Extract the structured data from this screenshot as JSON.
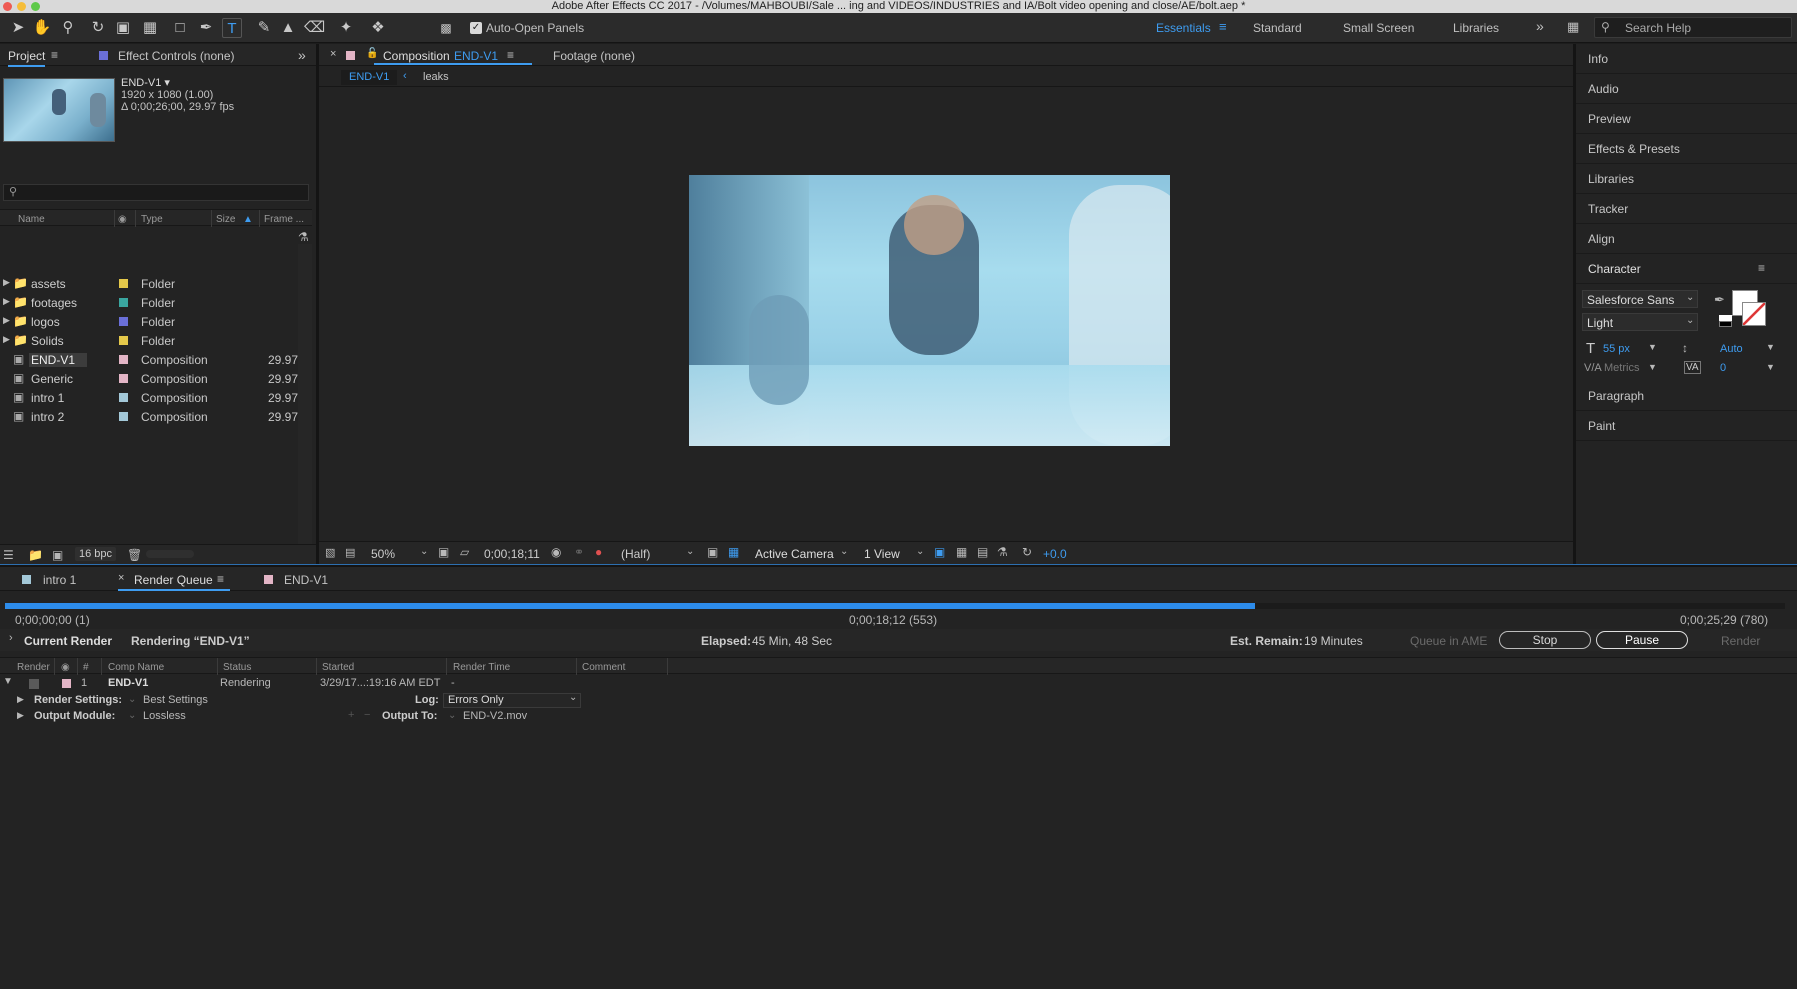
{
  "window": {
    "title": "Adobe After Effects CC 2017 - /Volumes/MAHBOUBI/Sale ... ing and VIDEOS/INDUSTRIES and IA/Bolt video opening and close/AE/bolt.aep *"
  },
  "toolbar": {
    "auto_open_label": "Auto-Open Panels",
    "workspaces": [
      "Essentials",
      "Standard",
      "Small Screen",
      "Libraries"
    ],
    "search_placeholder": "Search Help"
  },
  "project_panel": {
    "tab_project": "Project",
    "tab_effect_controls": "Effect Controls (none)",
    "selected_name": "END-V1 ▾",
    "selected_res": "1920 x 1080 (1.00)",
    "selected_dur": "Δ 0;00;26;00, 29.97 fps",
    "columns": {
      "name": "Name",
      "type": "Type",
      "size": "Size",
      "frame": "Frame ..."
    },
    "items": [
      {
        "name": "assets",
        "type": "Folder",
        "frame": "",
        "color": "#e4c84a"
      },
      {
        "name": "footages",
        "type": "Folder",
        "frame": "",
        "color": "#3aa6a0"
      },
      {
        "name": "logos",
        "type": "Folder",
        "frame": "",
        "color": "#6a6fd8"
      },
      {
        "name": "Solids",
        "type": "Folder",
        "frame": "",
        "color": "#e4c84a"
      },
      {
        "name": "END-V1",
        "type": "Composition",
        "frame": "29.97",
        "color": "#e3b5c6"
      },
      {
        "name": "Generic",
        "type": "Composition",
        "frame": "29.97",
        "color": "#e3b5c6"
      },
      {
        "name": "intro 1",
        "type": "Composition",
        "frame": "29.97",
        "color": "#a3c8d8"
      },
      {
        "name": "intro 2",
        "type": "Composition",
        "frame": "29.97",
        "color": "#a3c8d8"
      }
    ],
    "bpc": "16 bpc"
  },
  "composition_panel": {
    "tab_composition": "Composition",
    "tab_comp_name": "END-V1",
    "tab_footage": "Footage (none)",
    "breadcrumb": [
      "END-V1",
      "leaks"
    ],
    "zoom": "50%",
    "timecode": "0;00;18;11",
    "resolution": "(Half)",
    "camera": "Active Camera",
    "views": "1 View",
    "exposure": "+0.0"
  },
  "right_panel": {
    "items_top": [
      "Info",
      "Audio",
      "Preview",
      "Effects & Presets",
      "Libraries",
      "Tracker",
      "Align",
      "Character"
    ],
    "font_family": "Salesforce Sans",
    "font_style": "Light",
    "font_size": "55 px",
    "leading": "Auto",
    "kerning": "Metrics",
    "tracking": "0",
    "items_bottom": [
      "Paragraph",
      "Paint"
    ]
  },
  "render_queue": {
    "tabs": [
      "intro 1",
      "Render Queue",
      "END-V1"
    ],
    "progress": 0.702,
    "time_start": "0;00;00;00 (1)",
    "time_current": "0;00;18;12 (553)",
    "time_end": "0;00;25;29 (780)",
    "current_render_label": "Current Render",
    "rendering_text": "Rendering “END-V1”",
    "elapsed_label": "Elapsed:",
    "elapsed_value": "45 Min, 48 Sec",
    "remain_label": "Est. Remain:",
    "remain_value": "19 Minutes",
    "queue_ame": "Queue in AME",
    "stop": "Stop",
    "pause": "Pause",
    "render": "Render",
    "columns": {
      "render": "Render",
      "num": "#",
      "comp": "Comp Name",
      "status": "Status",
      "started": "Started",
      "render_time": "Render Time",
      "comment": "Comment"
    },
    "item": {
      "num": "1",
      "comp": "END-V1",
      "status": "Rendering",
      "started": "3/29/17...:19:16 AM EDT",
      "render_time": "-"
    },
    "render_settings_label": "Render Settings:",
    "render_settings_value": "Best Settings",
    "log_label": "Log:",
    "log_value": "Errors Only",
    "output_module_label": "Output Module:",
    "output_module_value": "Lossless",
    "output_to_label": "Output To:",
    "output_to_value": "END-V2.mov"
  },
  "colors": {
    "accent": "#3e9cf0",
    "panel": "#232323",
    "toolbar": "#2b2b2b",
    "progress": "#2d8ceb"
  }
}
